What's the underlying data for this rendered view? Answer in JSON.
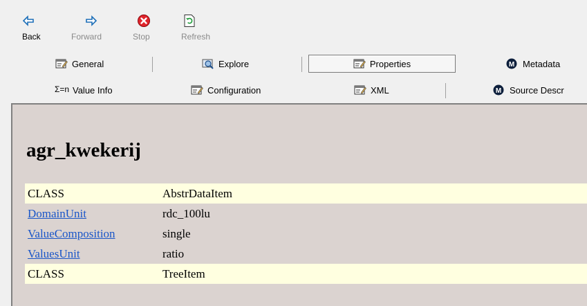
{
  "nav": {
    "back": "Back",
    "forward": "Forward",
    "stop": "Stop",
    "refresh": "Refresh"
  },
  "tabs": {
    "general": "General",
    "explore": "Explore",
    "properties": "Properties",
    "metadata": "Metadata",
    "value_info": "Value Info",
    "configuration": "Configuration",
    "xml": "XML",
    "source_descr": "Source Descr"
  },
  "page": {
    "title": "agr_kwekerij",
    "rows": [
      {
        "key": "CLASS",
        "value": "AbstrDataItem",
        "link": false,
        "highlight": true
      },
      {
        "key": "DomainUnit",
        "value": "rdc_100lu",
        "link": true,
        "highlight": false
      },
      {
        "key": "ValueComposition",
        "value": "single",
        "link": true,
        "highlight": false
      },
      {
        "key": "ValuesUnit",
        "value": "ratio",
        "link": true,
        "highlight": false
      },
      {
        "key": "CLASS",
        "value": "TreeItem",
        "link": false,
        "highlight": true
      }
    ]
  },
  "colors": {
    "content_bg": "#dbd3d0",
    "highlight_row": "#ffffe0",
    "link": "#1a56c8"
  }
}
